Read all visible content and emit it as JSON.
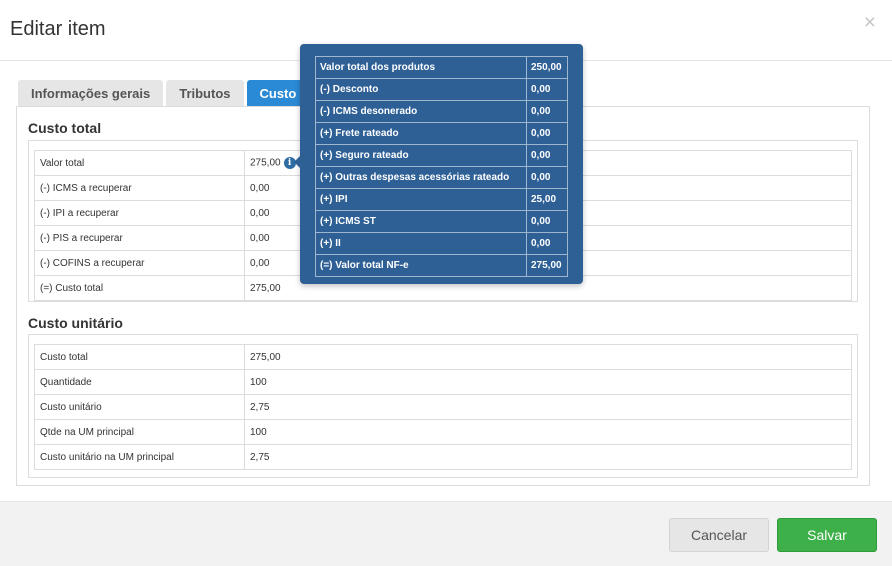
{
  "modal": {
    "title": "Editar item",
    "close_label": "×"
  },
  "tabs": [
    {
      "label": "Informações gerais",
      "active": false
    },
    {
      "label": "Tributos",
      "active": false
    },
    {
      "label": "Custo",
      "active": true
    }
  ],
  "custo_total": {
    "title": "Custo total",
    "rows": [
      {
        "label": "Valor total",
        "value": "275,00"
      },
      {
        "label": "(-) ICMS a recuperar",
        "value": "0,00"
      },
      {
        "label": "(-) IPI a recuperar",
        "value": "0,00"
      },
      {
        "label": "(-) PIS a recuperar",
        "value": "0,00"
      },
      {
        "label": "(-) COFINS a recuperar",
        "value": "0,00"
      },
      {
        "label": "(=) Custo total",
        "value": "275,00"
      }
    ]
  },
  "custo_unitario": {
    "title": "Custo unitário",
    "rows": [
      {
        "label": "Custo total",
        "value": "275,00"
      },
      {
        "label": "Quantidade",
        "value": "100"
      },
      {
        "label": "Custo unitário",
        "value": "2,75"
      },
      {
        "label": "Qtde na UM principal",
        "value": "100"
      },
      {
        "label": "Custo unitário na UM principal",
        "value": "2,75"
      }
    ]
  },
  "tooltip": {
    "rows": [
      {
        "label": "Valor total dos produtos",
        "value": "250,00"
      },
      {
        "label": "(-) Desconto",
        "value": "0,00"
      },
      {
        "label": "(-) ICMS desonerado",
        "value": "0,00"
      },
      {
        "label": "(+) Frete rateado",
        "value": "0,00"
      },
      {
        "label": "(+) Seguro rateado",
        "value": "0,00"
      },
      {
        "label": "(+) Outras despesas acessórias rateado",
        "value": "0,00"
      },
      {
        "label": "(+) IPI",
        "value": "25,00"
      },
      {
        "label": "(+) ICMS ST",
        "value": "0,00"
      },
      {
        "label": "(+) II",
        "value": "0,00"
      },
      {
        "label": "(=) Valor total NF-e",
        "value": "275,00"
      }
    ]
  },
  "footer": {
    "cancel_label": "Cancelar",
    "save_label": "Salvar"
  },
  "colors": {
    "accent": "#2b8ad6",
    "tooltip_bg": "#2e6096",
    "save": "#3db04a"
  }
}
